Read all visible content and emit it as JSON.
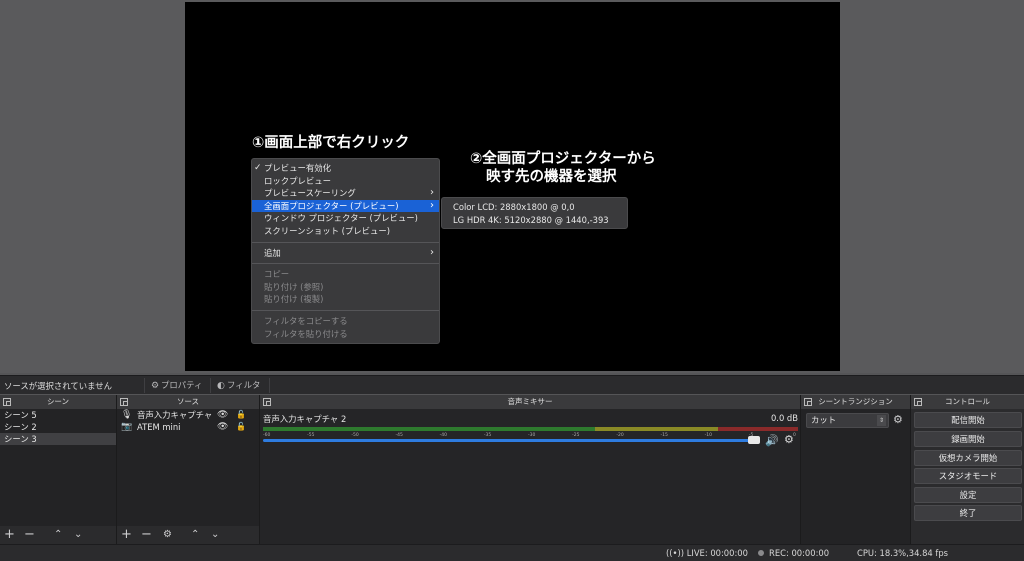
{
  "annotations": {
    "step1": "①画面上部で右クリック",
    "step2_line1": "②全画面プロジェクターから",
    "step2_line2": "映す先の機器を選択"
  },
  "context_menu": {
    "items": [
      {
        "label": "プレビュー有効化",
        "checked": true
      },
      {
        "label": "ロックプレビュー"
      },
      {
        "label": "プレビュースケーリング",
        "submenu": true
      },
      {
        "label": "全画面プロジェクター (プレビュー)",
        "submenu": true,
        "active": true
      },
      {
        "label": "ウィンドウ プロジェクター (プレビュー)"
      },
      {
        "label": "スクリーンショット (プレビュー)"
      },
      {
        "label": "追加",
        "submenu": true
      },
      {
        "label": "コピー",
        "disabled": true
      },
      {
        "label": "貼り付け (参照)",
        "disabled": true
      },
      {
        "label": "貼り付け (複製)",
        "disabled": true
      },
      {
        "label": "フィルタをコピーする",
        "disabled": true
      },
      {
        "label": "フィルタを貼り付ける",
        "disabled": true
      }
    ],
    "check_mark": "✓",
    "arrow": "›"
  },
  "projector_submenu": {
    "items": [
      "Color LCD: 2880x1800 @ 0,0",
      "LG HDR 4K: 5120x2880 @ 1440,-393"
    ]
  },
  "toolbar": {
    "status": "ソースが選択されていません",
    "properties": "プロパティ",
    "filters": "フィルタ"
  },
  "panels": {
    "scenes": {
      "title": "シーン",
      "items": [
        "シーン 5",
        "シーン 2",
        "シーン 3"
      ],
      "selected_index": 2
    },
    "sources": {
      "title": "ソース",
      "items": [
        {
          "label": "音声入力キャプチャ",
          "icon": "mic-icon"
        },
        {
          "label": "ATEM mini",
          "icon": "camera-icon"
        }
      ]
    },
    "mixer": {
      "title": "音声ミキサー",
      "channel": "音声入力キャプチャ 2",
      "level": "0.0 dB",
      "ticks": [
        "-60",
        "-55",
        "-50",
        "-45",
        "-40",
        "-35",
        "-30",
        "-25",
        "-20",
        "-15",
        "-10",
        "-5",
        "0"
      ]
    },
    "transitions": {
      "title": "シーントランジション",
      "selected": "カット"
    },
    "controls": {
      "title": "コントロール",
      "buttons": [
        "配信開始",
        "録画開始",
        "仮想カメラ開始",
        "スタジオモード",
        "設定",
        "終了"
      ]
    }
  },
  "statusbar": {
    "live": "LIVE: 00:00:00",
    "rec": "REC: 00:00:00",
    "cpu": "CPU: 18.3%,34.84 fps"
  },
  "colors": {
    "menu_highlight": "#1a62d6",
    "volume_bar": "#2e7ce0",
    "meter_green": "#2e7a2e",
    "meter_yellow": "#8a8a26",
    "meter_red": "#8a2a2a"
  }
}
